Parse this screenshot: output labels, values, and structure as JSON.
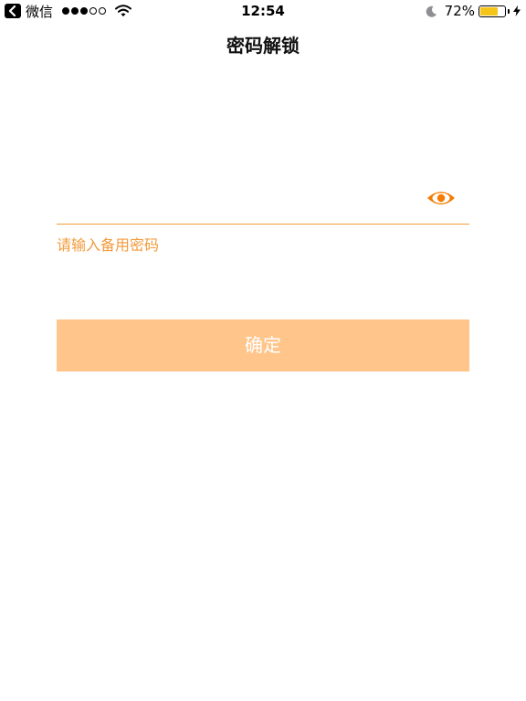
{
  "status_bar": {
    "back_app": "微信",
    "signal_dots": [
      true,
      true,
      true,
      false,
      false
    ],
    "time": "12:54",
    "battery_percent": "72%",
    "battery_level": 0.72,
    "battery_color": "#f5c518"
  },
  "nav": {
    "title": "密码解锁"
  },
  "password": {
    "value": "",
    "placeholder": "",
    "eye_icon": "eye-icon",
    "accent_color": "#f39a3b"
  },
  "hint": {
    "text": "请输入备用密码"
  },
  "confirm": {
    "label": "确定",
    "color": "#ffc58a"
  }
}
